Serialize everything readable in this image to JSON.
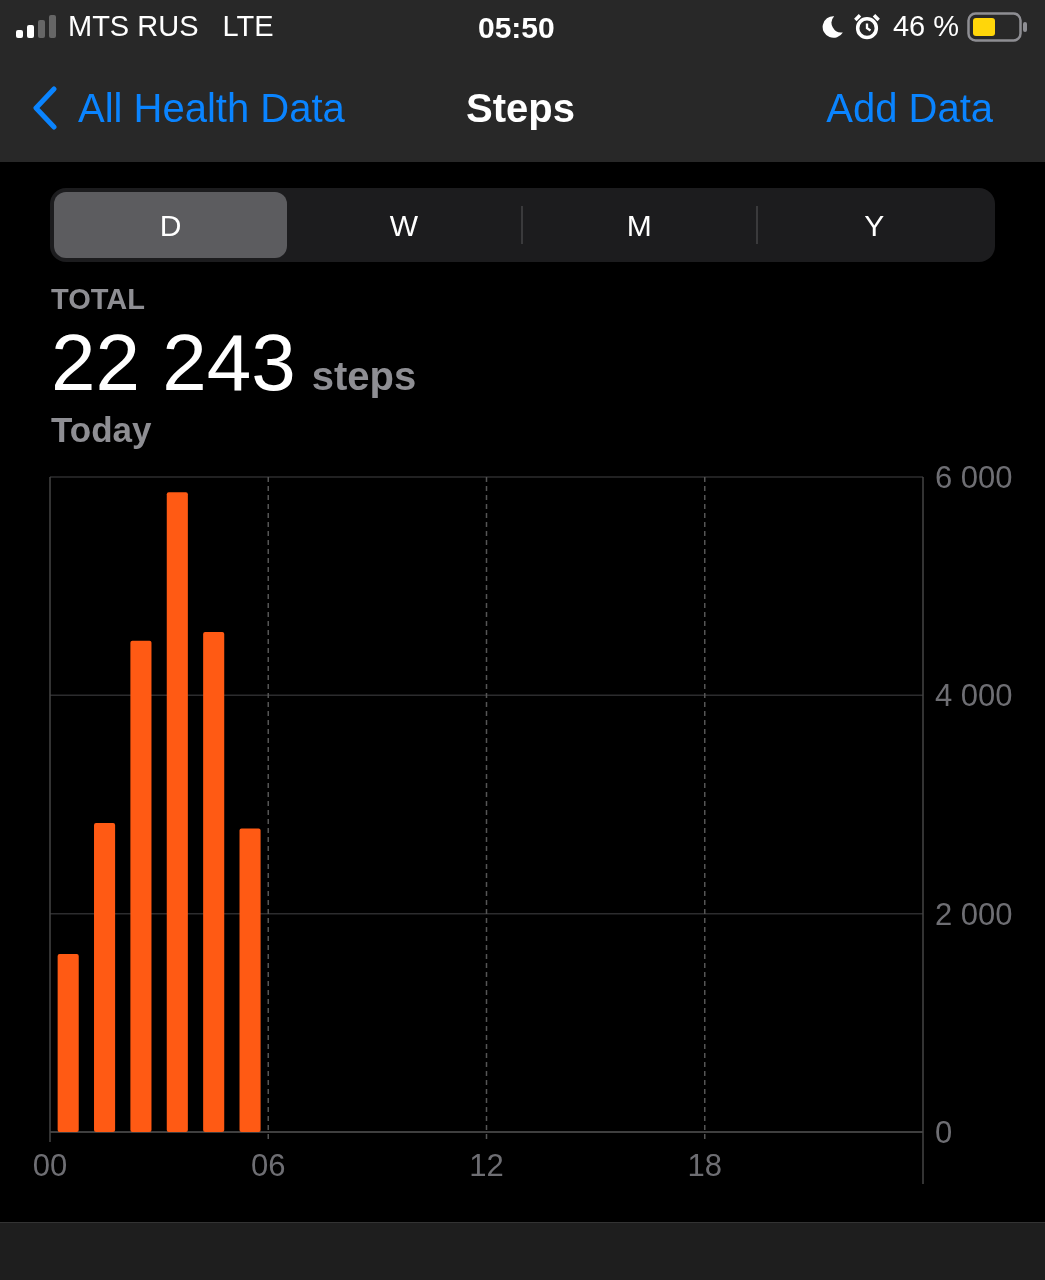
{
  "status_bar": {
    "carrier": "MTS RUS",
    "network": "LTE",
    "time": "05:50",
    "battery": "46 %"
  },
  "nav": {
    "back": "All Health Data",
    "title": "Steps",
    "action": "Add Data"
  },
  "segments": [
    {
      "label": "D",
      "selected": true
    },
    {
      "label": "W",
      "selected": false
    },
    {
      "label": "M",
      "selected": false
    },
    {
      "label": "Y",
      "selected": false
    }
  ],
  "summary": {
    "label": "TOTAL",
    "value": "22 243",
    "unit": "steps",
    "period": "Today"
  },
  "chart_data": {
    "type": "bar",
    "x": [
      0.5,
      1.5,
      2.5,
      3.5,
      4.5,
      5.5
    ],
    "grid": true,
    "xlim": [
      0,
      24
    ],
    "ylim": [
      0,
      6000
    ],
    "series": [
      {
        "color": "#ff5a14",
        "values": [
          1630,
          2830,
          4500,
          5860,
          4580,
          2780
        ]
      }
    ],
    "xticks": [
      {
        "value": 0,
        "label": "00"
      },
      {
        "value": 6,
        "label": "06"
      },
      {
        "value": 12,
        "label": "12"
      },
      {
        "value": 18,
        "label": "18"
      }
    ],
    "yticks": [
      {
        "value": 0,
        "label": "0"
      },
      {
        "value": 2000,
        "label": "2 000"
      },
      {
        "value": 4000,
        "label": "4 000"
      },
      {
        "value": 6000,
        "label": "6 000"
      }
    ]
  }
}
